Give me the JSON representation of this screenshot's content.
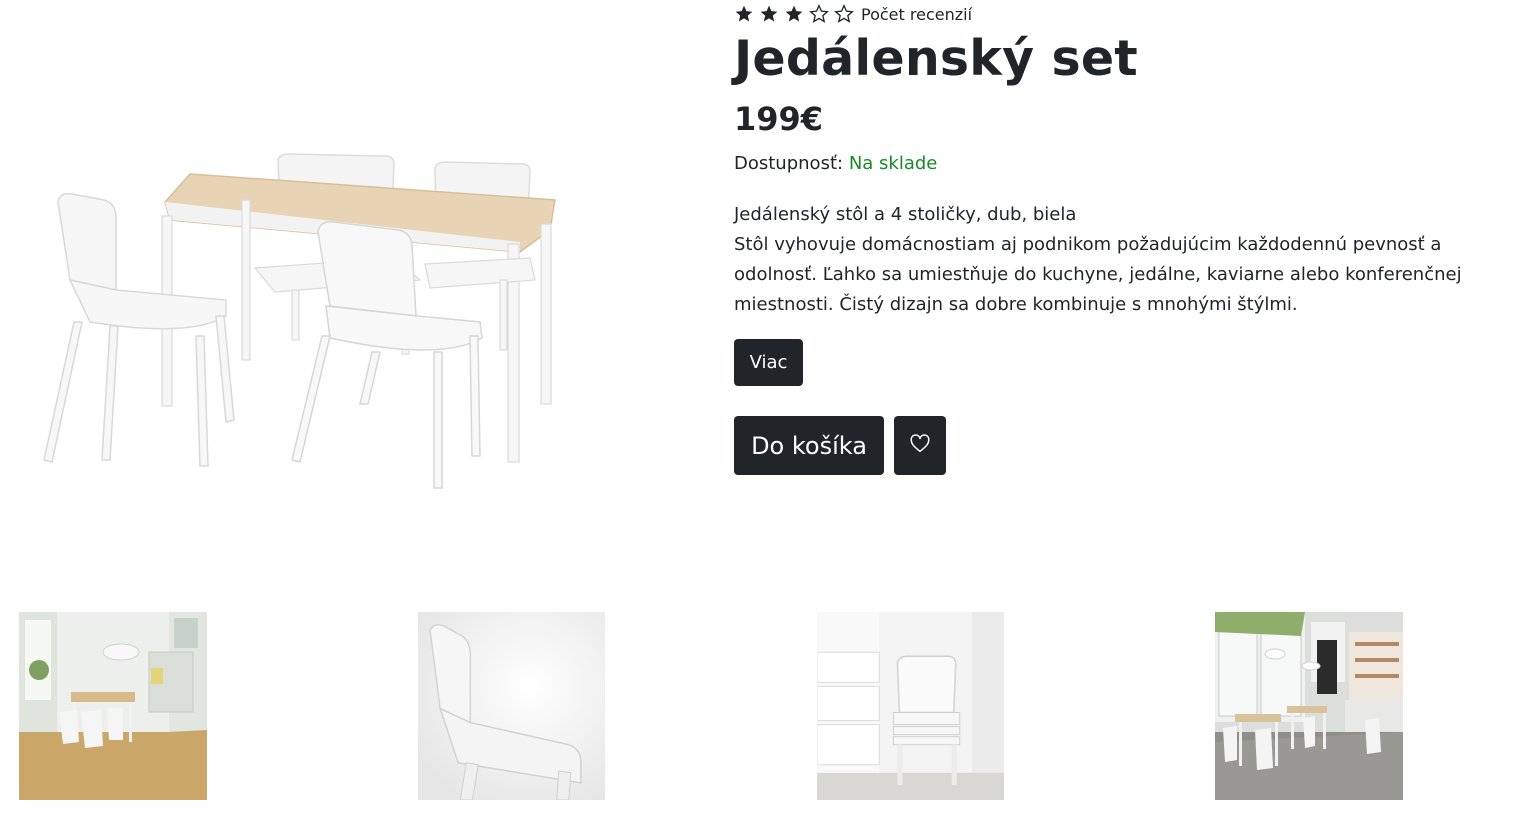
{
  "product": {
    "rating_label": "Počet recenzií",
    "rating": {
      "value": 3,
      "max": 5
    },
    "title": "Jedálenský set",
    "price": "199€",
    "availability_label": "Dostupnosť:",
    "availability_value": "Na sklade",
    "description_line1": "Jedálenský stôl a 4 stoličky, dub, biela",
    "description_line2": "Stôl vyhovuje domácnostiam aj podnikom požadujúcim každodennú pevnosť a odolnosť. Ľahko sa umiestňuje do kuchyne, jedálne, kaviarne alebo konferenčnej miestnosti. Čistý dizajn sa dobre kombinuje s mnohými štýlmi.",
    "more_button": "Viac",
    "cart_button": "Do košíka",
    "favorite_icon": "heart-icon"
  },
  "images": {
    "main": "dining-set-image",
    "thumbnails": [
      "room-scene-thumbnail",
      "chair-closeup-thumbnail",
      "stacked-chairs-thumbnail",
      "cafe-scene-thumbnail"
    ]
  },
  "colors": {
    "text": "#212529",
    "button_bg": "#212529",
    "in_stock": "#198a2a"
  }
}
